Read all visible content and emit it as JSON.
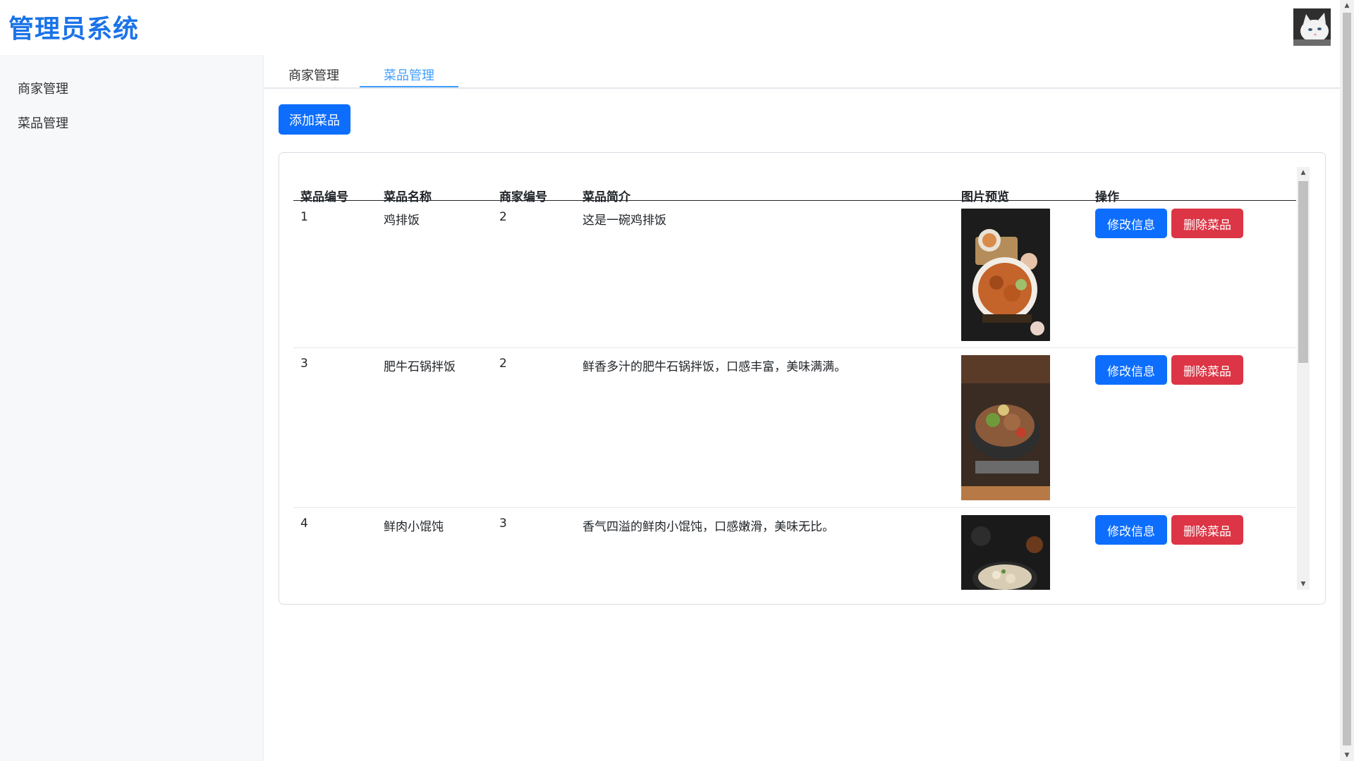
{
  "app": {
    "title": "管理员系统"
  },
  "sidebar": {
    "items": [
      {
        "label": "商家管理"
      },
      {
        "label": "菜品管理"
      }
    ]
  },
  "tabs": [
    {
      "label": "商家管理",
      "active": false
    },
    {
      "label": "菜品管理",
      "active": true
    }
  ],
  "toolbar": {
    "add_label": "添加菜品"
  },
  "table": {
    "headers": [
      "菜品编号",
      "菜品名称",
      "商家编号",
      "菜品简介",
      "图片预览",
      "操作"
    ],
    "rows": [
      {
        "id": "1",
        "name": "鸡排饭",
        "merchant": "2",
        "desc": "这是一碗鸡排饭",
        "edit_label": "修改信息",
        "delete_label": "删除菜品"
      },
      {
        "id": "3",
        "name": "肥牛石锅拌饭",
        "merchant": "2",
        "desc": "鲜香多汁的肥牛石锅拌饭，口感丰富，美味满满。",
        "edit_label": "修改信息",
        "delete_label": "删除菜品"
      },
      {
        "id": "4",
        "name": "鲜肉小馄饨",
        "merchant": "3",
        "desc": "香气四溢的鲜肉小馄饨，口感嫩滑，美味无比。",
        "edit_label": "修改信息",
        "delete_label": "删除菜品"
      }
    ]
  },
  "colors": {
    "brand": "#1a73e8",
    "primary": "#0d6efd",
    "danger": "#dc3545",
    "tab_active": "#409eff"
  },
  "icons": {
    "avatar": "cat-avatar",
    "scroll_up": "triangle-up",
    "scroll_down": "triangle-down"
  }
}
